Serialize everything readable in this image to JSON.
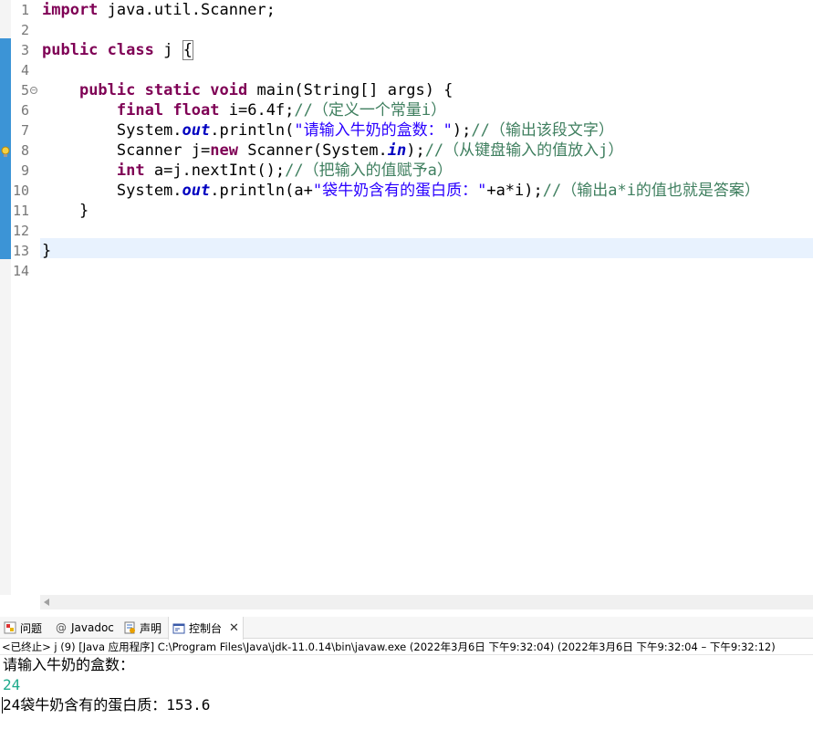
{
  "editor": {
    "line_numbers": [
      "1",
      "2",
      "3",
      "4",
      "5",
      "6",
      "7",
      "8",
      "9",
      "10",
      "11",
      "12",
      "13",
      "14"
    ],
    "lines": [
      [
        {
          "t": "import",
          "c": "kw"
        },
        {
          "t": " java.util.Scanner;",
          "c": "ident"
        }
      ],
      [],
      [
        {
          "t": "public",
          "c": "kw"
        },
        {
          "t": " ",
          "c": "ident"
        },
        {
          "t": "class",
          "c": "kw"
        },
        {
          "t": " j ",
          "c": "ident"
        },
        {
          "t": "{",
          "c": "brace"
        }
      ],
      [],
      [
        {
          "t": "    ",
          "c": "ident"
        },
        {
          "t": "public",
          "c": "kw"
        },
        {
          "t": " ",
          "c": "ident"
        },
        {
          "t": "static",
          "c": "kw"
        },
        {
          "t": " ",
          "c": "ident"
        },
        {
          "t": "void",
          "c": "kw"
        },
        {
          "t": " main(String[] args) {",
          "c": "ident"
        }
      ],
      [
        {
          "t": "        ",
          "c": "ident"
        },
        {
          "t": "final",
          "c": "kw"
        },
        {
          "t": " ",
          "c": "ident"
        },
        {
          "t": "float",
          "c": "kw"
        },
        {
          "t": " i=6.4f;",
          "c": "ident"
        },
        {
          "t": "//（定义一个常量i）",
          "c": "cmt"
        }
      ],
      [
        {
          "t": "        System.",
          "c": "ident"
        },
        {
          "t": "out",
          "c": "fld"
        },
        {
          "t": ".println(",
          "c": "ident"
        },
        {
          "t": "\"请输入牛奶的盒数：\"",
          "c": "str"
        },
        {
          "t": ");",
          "c": "ident"
        },
        {
          "t": "//（输出该段文字）",
          "c": "cmt"
        }
      ],
      [
        {
          "t": "        Scanner j=",
          "c": "ident"
        },
        {
          "t": "new",
          "c": "kw"
        },
        {
          "t": " Scanner(System.",
          "c": "ident"
        },
        {
          "t": "in",
          "c": "fld"
        },
        {
          "t": ");",
          "c": "ident"
        },
        {
          "t": "//（从键盘输入的值放入j）",
          "c": "cmt"
        }
      ],
      [
        {
          "t": "        ",
          "c": "ident"
        },
        {
          "t": "int",
          "c": "kw"
        },
        {
          "t": " a=j.nextInt();",
          "c": "ident"
        },
        {
          "t": "//（把输入的值赋予a）",
          "c": "cmt"
        }
      ],
      [
        {
          "t": "        System.",
          "c": "ident"
        },
        {
          "t": "out",
          "c": "fld"
        },
        {
          "t": ".println(a+",
          "c": "ident"
        },
        {
          "t": "\"袋牛奶含有的蛋白质：\"",
          "c": "str"
        },
        {
          "t": "+a*i);",
          "c": "ident"
        },
        {
          "t": "//（输出a*i的值也就是答案）",
          "c": "cmt"
        }
      ],
      [
        {
          "t": "    }",
          "c": "ident"
        }
      ],
      [],
      [
        {
          "t": "}",
          "c": "ident"
        }
      ],
      []
    ]
  },
  "console": {
    "tabs": [
      {
        "label": "问题",
        "icon": "problems-icon",
        "active": false
      },
      {
        "label": "Javadoc",
        "icon": "at-icon",
        "active": false
      },
      {
        "label": "声明",
        "icon": "declaration-icon",
        "active": false
      },
      {
        "label": "控制台",
        "icon": "console-icon",
        "active": true
      }
    ],
    "status": "<已终止> j (9)  [Java 应用程序] C:\\Program Files\\Java\\jdk-11.0.14\\bin\\javaw.exe  (2022年3月6日 下午9:32:04)  (2022年3月6日 下午9:32:04 – 下午9:32:12)",
    "output": [
      {
        "text": "请输入牛奶的盒数：",
        "color": "#000000"
      },
      {
        "text": "24",
        "color": "#1faa8c"
      },
      {
        "text": "24袋牛奶含有的蛋白质：153.6",
        "color": "#000000"
      }
    ]
  },
  "colors": {
    "keyword": "#7f0055",
    "string": "#2a00ff",
    "comment": "#3f7f5f",
    "field": "#0000c0",
    "current_line": "#e8f2fe",
    "change_bar": "#3c94d6"
  }
}
